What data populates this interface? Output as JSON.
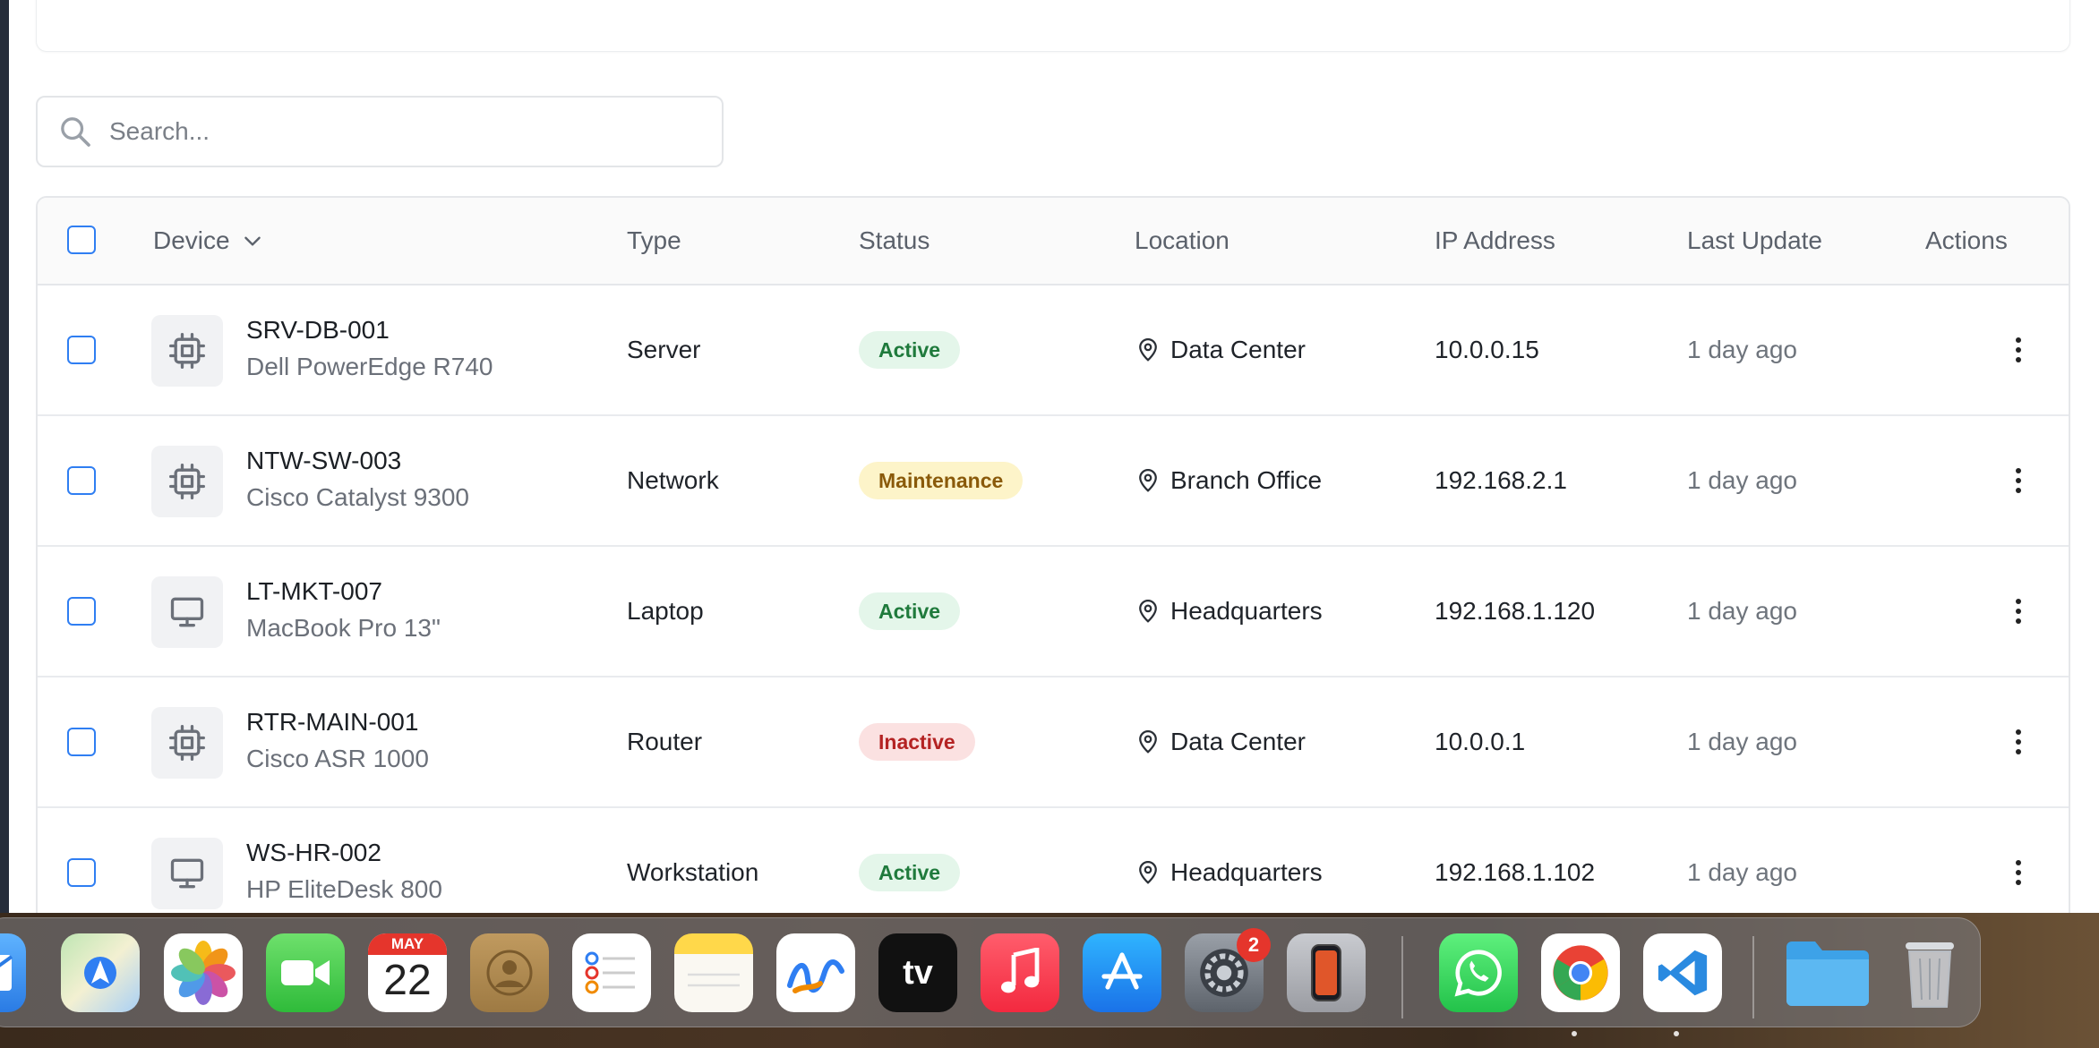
{
  "search": {
    "placeholder": "Search..."
  },
  "table": {
    "headers": {
      "device": "Device",
      "type": "Type",
      "status": "Status",
      "location": "Location",
      "ip": "IP Address",
      "last_update": "Last Update",
      "actions": "Actions"
    },
    "rows": [
      {
        "name": "SRV-DB-001",
        "model": "Dell PowerEdge R740",
        "icon": "chip-icon",
        "type": "Server",
        "status": "Active",
        "location": "Data Center",
        "ip": "10.0.0.15",
        "last_update": "1 day ago"
      },
      {
        "name": "NTW-SW-003",
        "model": "Cisco Catalyst 9300",
        "icon": "chip-icon",
        "type": "Network",
        "status": "Maintenance",
        "location": "Branch Office",
        "ip": "192.168.2.1",
        "last_update": "1 day ago"
      },
      {
        "name": "LT-MKT-007",
        "model": "MacBook Pro 13\"",
        "icon": "monitor-icon",
        "type": "Laptop",
        "status": "Active",
        "location": "Headquarters",
        "ip": "192.168.1.120",
        "last_update": "1 day ago"
      },
      {
        "name": "RTR-MAIN-001",
        "model": "Cisco ASR 1000",
        "icon": "chip-icon",
        "type": "Router",
        "status": "Inactive",
        "location": "Data Center",
        "ip": "10.0.0.1",
        "last_update": "1 day ago"
      },
      {
        "name": "WS-HR-002",
        "model": "HP EliteDesk 800",
        "icon": "monitor-icon",
        "type": "Workstation",
        "status": "Active",
        "location": "Headquarters",
        "ip": "192.168.1.102",
        "last_update": "1 day ago"
      }
    ]
  },
  "status_colors": {
    "Active": "#1f7a3c",
    "Maintenance": "#8a5a0a",
    "Inactive": "#b42323"
  },
  "dock": {
    "calendar": {
      "month": "MAY",
      "day": "22"
    },
    "settings_badge": "2",
    "apps": [
      "mail",
      "maps",
      "photos",
      "facetime",
      "calendar",
      "contacts",
      "reminders",
      "notes",
      "freeform",
      "apple-tv",
      "music",
      "app-store",
      "system-settings",
      "iphone-mirroring",
      "whatsapp",
      "chrome",
      "vscode",
      "folder",
      "trash"
    ],
    "tv_label": "tv"
  }
}
